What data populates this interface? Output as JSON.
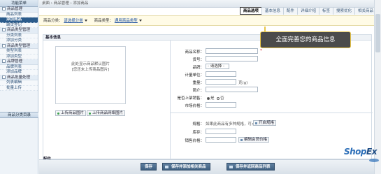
{
  "sidebar": {
    "title": "功能菜单",
    "groups": [
      {
        "label": "商品管理",
        "items": [
          "商品列表",
          "添加商品",
          "缺货登记"
        ]
      },
      {
        "label": "商品类型管理",
        "items": [
          "分类列表",
          "添加分类"
        ]
      },
      {
        "label": "商品类型管理",
        "items": [
          "类型列表",
          "添加类型"
        ]
      },
      {
        "label": "品牌管理",
        "items": [
          "品牌列表",
          "添加品牌"
        ]
      },
      {
        "label": "商品批量处理",
        "items": [
          "列表编辑",
          "批量上传"
        ]
      }
    ],
    "active_item": "添加商品",
    "bottom": "商品分类目录"
  },
  "breadcrumb": "桌面 › 商品管理 › 添加商品",
  "tabs": [
    "商品选项",
    "基本信息",
    "配件",
    "详细介绍",
    "标签",
    "搜索优化",
    "相关商品"
  ],
  "category_row": {
    "category_label": "商品分类：",
    "category_link": "请选择分类",
    "type_label": "商品类型：",
    "type_link": "通用商品类型"
  },
  "tooltip": "全面完善您的商品信息",
  "section": {
    "title": "基本信息",
    "image_hint_1": "此处显示商品默认图片",
    "image_hint_2": "[您还未上传商品图片]",
    "upload_btn": "上传商品图片",
    "network_btn": "上传商品网络图片",
    "fields": {
      "name": "商品名称：",
      "bn": "货号：",
      "brand": "品牌：",
      "brand_select": "- 请选择 -",
      "unit": "计量单位：",
      "weight": "重量：",
      "weight_unit": "克(g)",
      "brief": "简介：",
      "marketable": "是否上架销售：",
      "yes": "是",
      "no": "否",
      "mktprice": "市场价格：",
      "spec": "规格：",
      "spec_note": "如果此商品有多种规格，可点此",
      "spec_btn": "开启规格",
      "store": "库存：",
      "price": "销售价格：",
      "member_price_btn": "编辑会员价格"
    }
  },
  "sub_section": "配件",
  "footer": {
    "save": "保存",
    "save_continue": "保存并添加相关商品",
    "save_return": "保存并返回商品列表"
  },
  "logo": {
    "text_a": "Shop",
    "text_b": "Ex"
  },
  "colors": {
    "accent": "#2b5b8b",
    "tooltip_bg": "#4b4b4b",
    "tooltip_border": "#e9c64a",
    "category_bg": "#fffbe6"
  }
}
